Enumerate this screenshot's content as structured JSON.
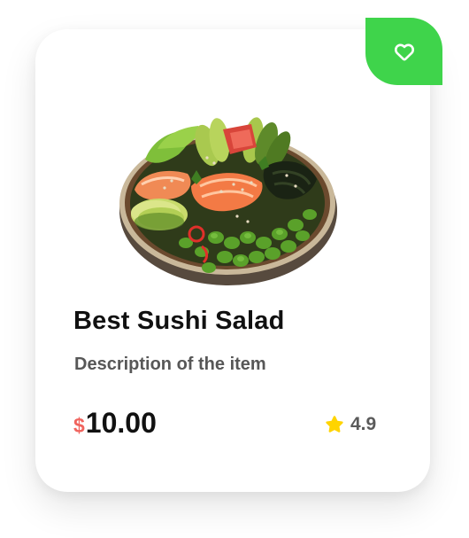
{
  "card": {
    "title": "Best Sushi Salad",
    "description": "Description of the item",
    "price": {
      "currency": "$",
      "amount": "10.00"
    },
    "rating": {
      "value": "4.9",
      "icon": "star-icon"
    },
    "favorite": {
      "icon": "heart-icon"
    },
    "image": {
      "subject": "sushi-salad-bowl"
    }
  },
  "colors": {
    "accent_green": "#3fd44b",
    "price_currency": "#f0645e",
    "star_yellow": "#ffd400",
    "title_text": "#111111",
    "secondary_text": "#575757"
  }
}
